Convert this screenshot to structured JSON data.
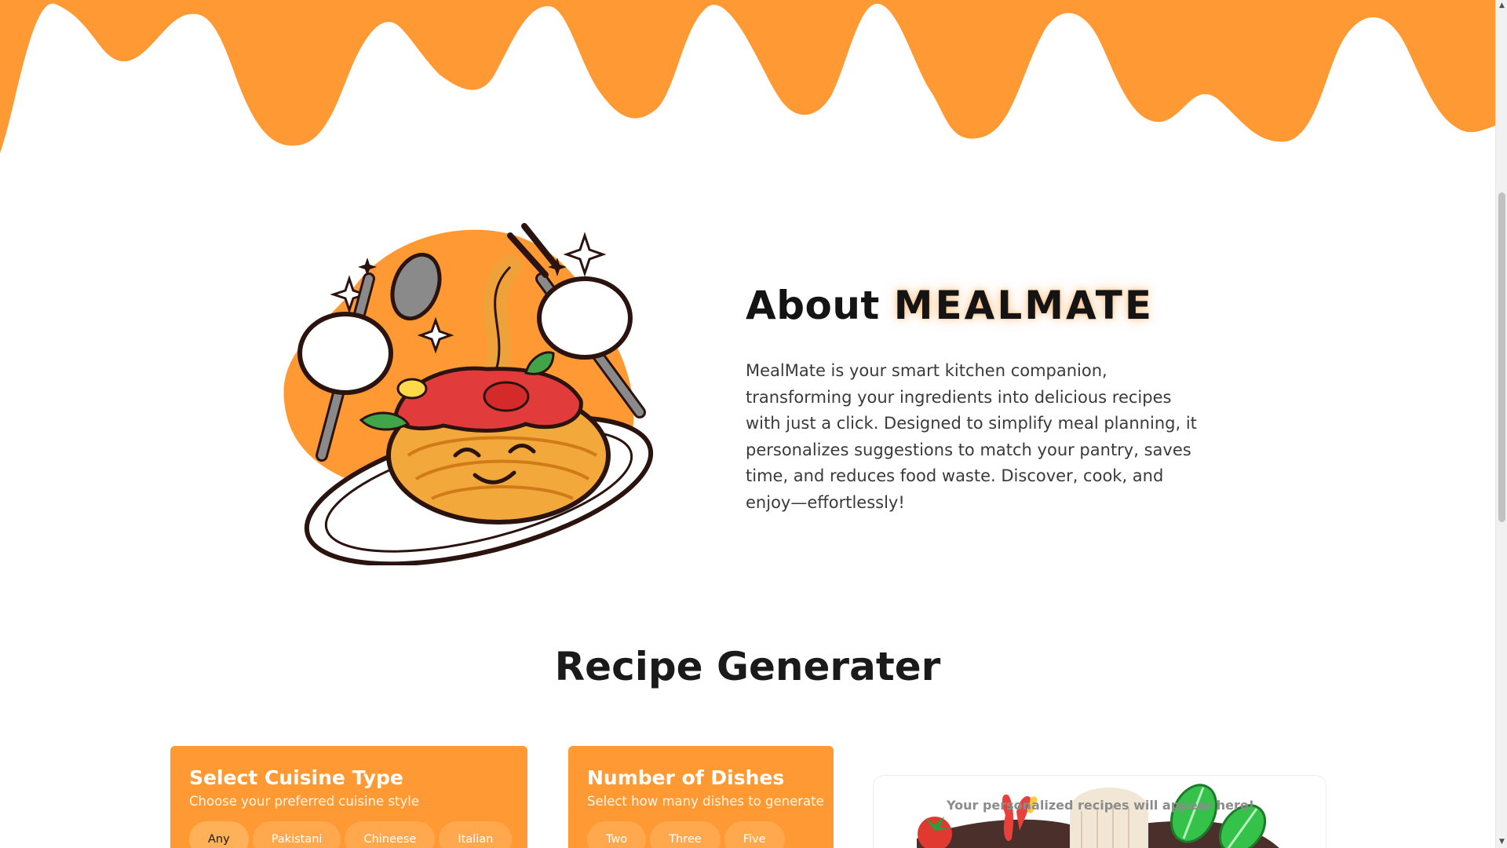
{
  "theme": {
    "accent": "#FF9933",
    "text": "#1A1A1A"
  },
  "about": {
    "title_prefix": "About",
    "title_brand": "MEALMATE",
    "description": "MealMate is your smart kitchen companion, transforming your ingredients into delicious recipes with just a click. Designed to simplify meal planning, it personalizes suggestions to match your pantry, saves time, and reduces food waste. Discover, cook, and enjoy—effortlessly!"
  },
  "generator": {
    "title": "Recipe Generater",
    "cuisine": {
      "title": "Select Cuisine Type",
      "subtitle": "Choose your preferred cuisine style",
      "options": [
        "Any",
        "Pakistani",
        "Chineese",
        "Italian"
      ],
      "selected": "Any"
    },
    "dishes": {
      "title": "Number of Dishes",
      "subtitle": "Select how many dishes to generate",
      "options": [
        "Two",
        "Three",
        "Five"
      ]
    },
    "output": {
      "placeholder": "Your personalized recipes will appear here!"
    }
  },
  "icons": {
    "hero": "spaghetti-mascot-illustration",
    "output_art": "chef-vegetables-illustration"
  }
}
